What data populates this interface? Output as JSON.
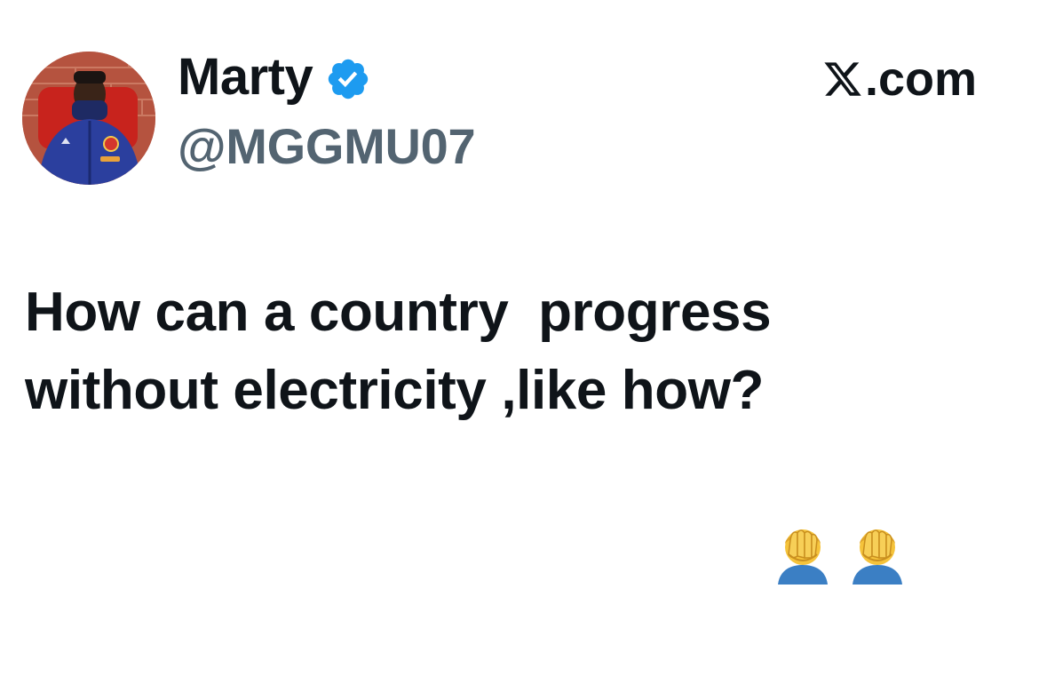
{
  "author": {
    "display_name": "Marty",
    "handle": "@MGGMU07",
    "verified": true,
    "verified_badge_icon": "verified-check-icon",
    "avatar_icon": "profile-photo"
  },
  "source": {
    "logo_icon": "x-logo-icon",
    "label": ".com"
  },
  "tweet": {
    "text_line_1": "How can a country  progress",
    "text_line_2": "without electricity ,like how?",
    "emojis": [
      "facepalm-icon",
      "facepalm-icon"
    ]
  },
  "colors": {
    "text_primary": "#0f1419",
    "text_secondary": "#536471",
    "verified_blue": "#1d9bf0",
    "background": "#ffffff"
  }
}
